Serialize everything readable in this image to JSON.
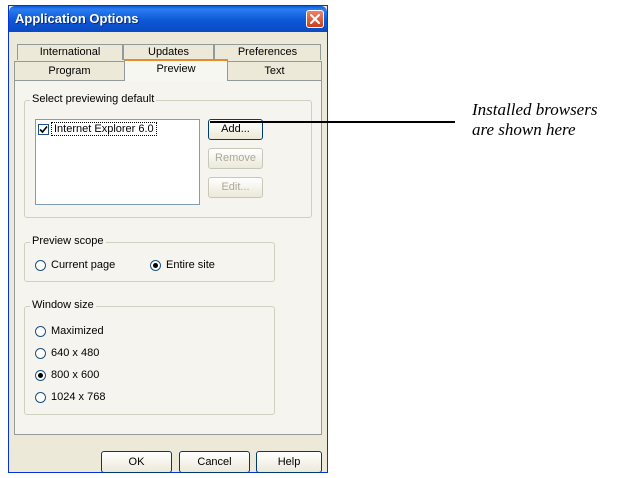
{
  "window": {
    "title": "Application Options"
  },
  "tabs": {
    "row1": [
      "International",
      "Updates",
      "Preferences"
    ],
    "row2": [
      "Program",
      "Preview",
      "Text"
    ],
    "active": "Preview"
  },
  "browsers_group": {
    "label": "Select previewing default",
    "items": [
      {
        "label": "Internet Explorer 6.0",
        "checked": true,
        "selected": true
      }
    ],
    "add_button": "Add...",
    "remove_button": "Remove",
    "edit_button": "Edit..."
  },
  "scope_group": {
    "label": "Preview scope",
    "options": [
      {
        "label": "Current page",
        "selected": false
      },
      {
        "label": "Entire site",
        "selected": true
      }
    ]
  },
  "window_size_group": {
    "label": "Window size",
    "options": [
      {
        "label": "Maximized",
        "selected": false
      },
      {
        "label": "640 x 480",
        "selected": false
      },
      {
        "label": "800 x 600",
        "selected": true
      },
      {
        "label": "1024 x 768",
        "selected": false
      }
    ]
  },
  "dialog_buttons": {
    "ok": "OK",
    "cancel": "Cancel",
    "help": "Help"
  },
  "annotation": {
    "line1": "Installed browsers",
    "line2": "are shown here"
  },
  "colors": {
    "titlebar": "#0a5bd8",
    "dialog_face": "#ece9d8",
    "active_tab_accent": "#e68b2c",
    "close_button": "#c7411d"
  },
  "icons": [
    "close-icon",
    "checkmark-icon"
  ]
}
